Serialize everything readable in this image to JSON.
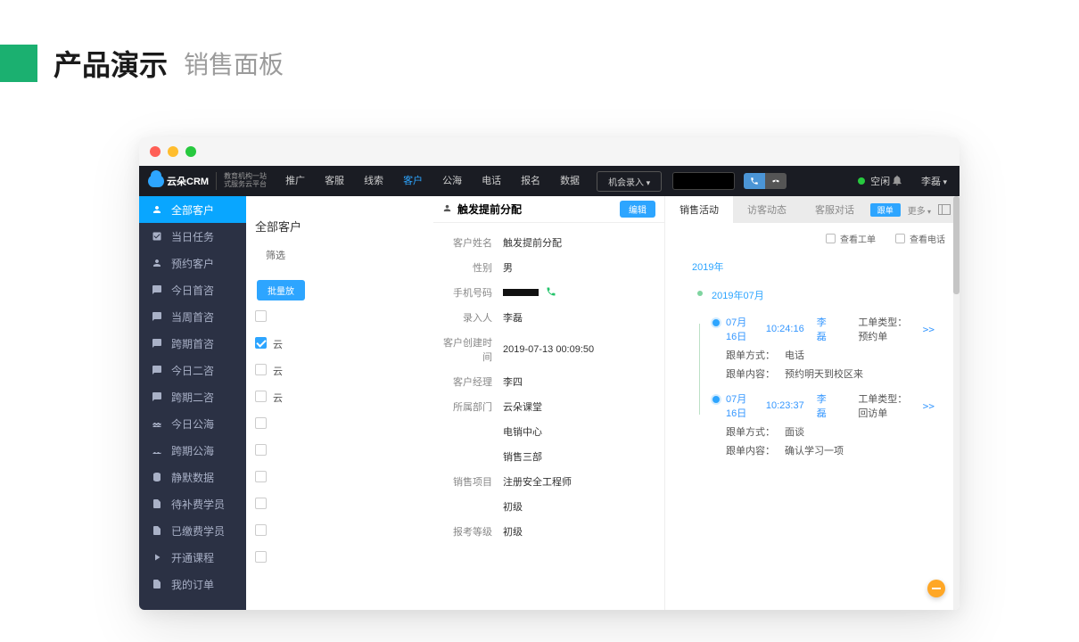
{
  "slide": {
    "badge_color": "#1bb070",
    "title": "产品演示",
    "subtitle": "销售面板"
  },
  "logo": {
    "brand": "云朵CRM",
    "tagline1": "教育机构一站",
    "tagline2": "式服务云平台"
  },
  "nav": {
    "items": [
      "推广",
      "客服",
      "线索",
      "客户",
      "公海",
      "电话",
      "报名",
      "数据"
    ],
    "active_index": 3,
    "opportunity": "机会录入"
  },
  "status": {
    "label": "空闲"
  },
  "user": {
    "name": "李磊"
  },
  "sidebar": {
    "items": [
      {
        "label": "全部客户",
        "icon": "user"
      },
      {
        "label": "当日任务",
        "icon": "check"
      },
      {
        "label": "预约客户",
        "icon": "user"
      },
      {
        "label": "今日首咨",
        "icon": "chat"
      },
      {
        "label": "当周首咨",
        "icon": "chat"
      },
      {
        "label": "跨期首咨",
        "icon": "chat"
      },
      {
        "label": "今日二咨",
        "icon": "chat"
      },
      {
        "label": "跨期二咨",
        "icon": "chat"
      },
      {
        "label": "今日公海",
        "icon": "sea"
      },
      {
        "label": "跨期公海",
        "icon": "sea"
      },
      {
        "label": "静默数据",
        "icon": "db"
      },
      {
        "label": "待补费学员",
        "icon": "doc"
      },
      {
        "label": "已缴费学员",
        "icon": "doc"
      },
      {
        "label": "开通课程",
        "icon": "play"
      },
      {
        "label": "我的订单",
        "icon": "doc"
      }
    ],
    "active_index": 0
  },
  "mid": {
    "title": "全部客户",
    "filter_label": "筛选",
    "batch_button": "批量放",
    "row_labels": [
      "云",
      "云",
      "云"
    ]
  },
  "detail": {
    "title": "触发提前分配",
    "edit": "编辑",
    "fields": [
      {
        "label": "客户姓名",
        "value": "触发提前分配"
      },
      {
        "label": "性别",
        "value": "男"
      },
      {
        "label": "手机号码",
        "value": "•••",
        "phone": true
      },
      {
        "label": "录入人",
        "value": "李磊"
      },
      {
        "label": "客户创建时间",
        "value": "2019-07-13 00:09:50"
      },
      {
        "label": "客户经理",
        "value": "李四"
      },
      {
        "label": "所属部门",
        "value": "云朵课堂"
      },
      {
        "label": "",
        "value": "电销中心"
      },
      {
        "label": "",
        "value": "销售三部"
      },
      {
        "label": "销售项目",
        "value": "注册安全工程师"
      },
      {
        "label": "",
        "value": "初级"
      },
      {
        "label": "报考等级",
        "value": "初级"
      }
    ]
  },
  "right_tabs": {
    "items": [
      "销售活动",
      "访客动态",
      "客服对话"
    ],
    "active_index": 0,
    "follow_tag": "跟单",
    "more": "更多"
  },
  "right_filters": {
    "opt1": "查看工单",
    "opt2": "查看电话"
  },
  "timeline": {
    "year": "2019年",
    "month": "2019年07月",
    "events": [
      {
        "date": "07月16日",
        "time": "10:24:16",
        "who": "李磊",
        "type_label": "工单类型：",
        "type_value": "预约单",
        "method_label": "跟单方式：",
        "method_value": "电话",
        "content_label": "跟单内容：",
        "content_value": "预约明天到校区来",
        "expand": ">>"
      },
      {
        "date": "07月16日",
        "time": "10:23:37",
        "who": "李磊",
        "type_label": "工单类型：",
        "type_value": "回访单",
        "method_label": "跟单方式：",
        "method_value": "面谈",
        "content_label": "跟单内容：",
        "content_value": "确认学习一项",
        "expand": ">>"
      }
    ]
  }
}
